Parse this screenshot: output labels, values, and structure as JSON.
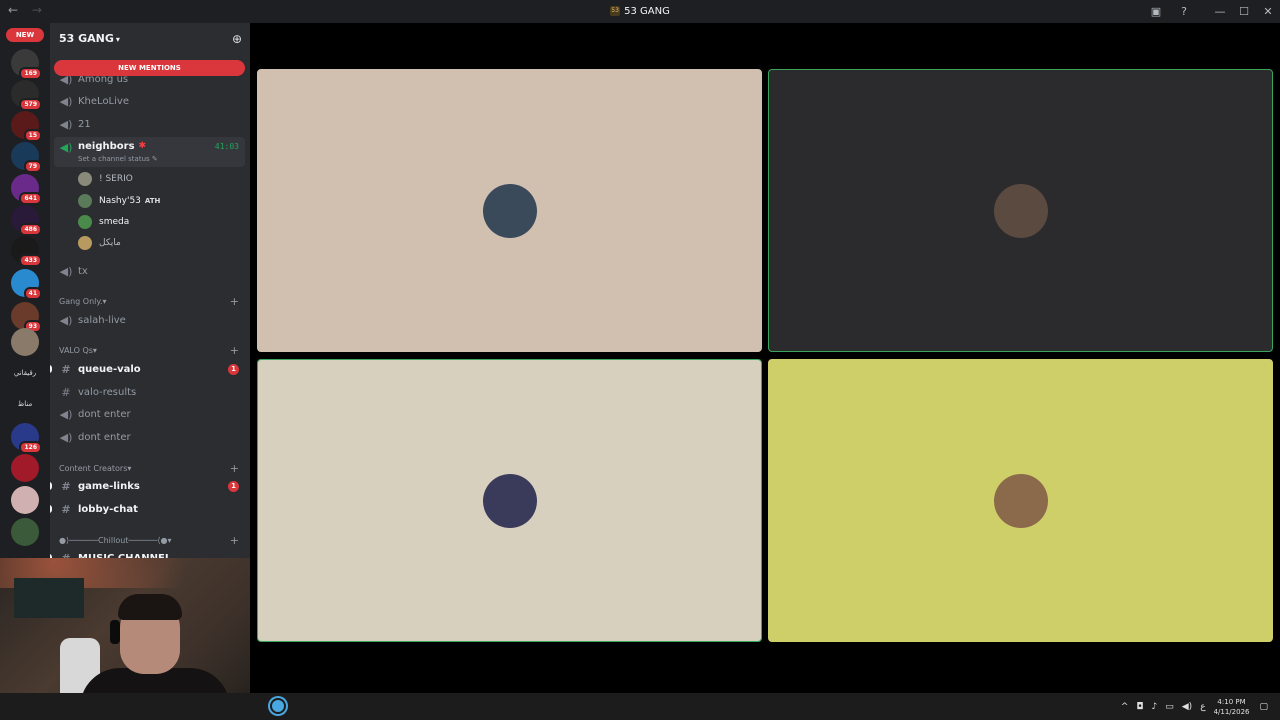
{
  "window": {
    "title": "53 GANG",
    "title_logo": "53",
    "nav_back": "←",
    "nav_forward": "→",
    "icons": [
      "inbox-icon",
      "help-icon",
      "minimize-icon",
      "maximize-icon",
      "close-icon"
    ]
  },
  "servers": {
    "new_label": "NEW",
    "items": [
      {
        "badge": "169",
        "color": "#3a3a3a"
      },
      {
        "badge": "579",
        "color": "#2b2b2b"
      },
      {
        "badge": "15",
        "color": "#5a1a1a"
      },
      {
        "badge": "79",
        "color": "#1a3a5a"
      },
      {
        "badge": "641",
        "color": "#6a2a8a"
      },
      {
        "badge": "486",
        "color": "#2a1a3a"
      },
      {
        "badge": "433",
        "color": "#1a1a1a"
      },
      {
        "badge": "41",
        "color": "#2a8ad0"
      },
      {
        "badge": "93",
        "color": "#6a3a2a"
      },
      {
        "badge": "",
        "color": "#8a7a6a"
      },
      {
        "badge": "",
        "color": "#1e1f22"
      },
      {
        "badge": "",
        "color": "#1e1f22"
      },
      {
        "badge": "126",
        "color": "#2a3a8a"
      },
      {
        "badge": "",
        "color": "#a01a2a"
      },
      {
        "badge": "",
        "color": "#d0b0b0"
      },
      {
        "badge": "",
        "color": "#3a5a3a"
      }
    ],
    "text_items": [
      "رقيقاني",
      "مناظ"
    ]
  },
  "guild": {
    "name": "53 GANG",
    "new_mentions": "NEW MENTIONS"
  },
  "channels": {
    "top": [
      {
        "name": "Among us",
        "icon": "speaker-icon"
      },
      {
        "name": "KheLoLive",
        "icon": "speaker-icon"
      },
      {
        "name": "21",
        "icon": "speaker-icon"
      }
    ],
    "active": {
      "name": "neighbors",
      "timer": "41:03",
      "status": "Set a channel status"
    },
    "voice_users": [
      {
        "name": "! SERIO",
        "color": "#8a8a7a",
        "bold": false,
        "tag": ""
      },
      {
        "name": "Nashy'53",
        "color": "#5a7a5a",
        "bold": true,
        "tag": "ATH"
      },
      {
        "name": "smeda",
        "color": "#4a8a4a",
        "bold": true,
        "tag": ""
      },
      {
        "name": "مايكل",
        "color": "#b89a60",
        "bold": false,
        "tag": ""
      }
    ],
    "after": {
      "name": "tx"
    },
    "categories": [
      {
        "name": "Gang Only.",
        "channels": [
          {
            "name": "salah-live",
            "icon": "speaker",
            "bold": false,
            "badge": ""
          }
        ]
      },
      {
        "name": "VALO Qs",
        "channels": [
          {
            "name": "queue-valo",
            "icon": "hash",
            "bold": true,
            "badge": "1"
          },
          {
            "name": "valo-results",
            "icon": "hash",
            "bold": false,
            "badge": ""
          },
          {
            "name": "dont enter",
            "icon": "speaker",
            "bold": false,
            "badge": ""
          },
          {
            "name": "dont enter",
            "icon": "speaker",
            "bold": false,
            "badge": ""
          }
        ]
      },
      {
        "name": "Content Creators",
        "channels": [
          {
            "name": "game-links",
            "icon": "hash",
            "bold": true,
            "badge": "1"
          },
          {
            "name": "lobby-chat",
            "icon": "hash",
            "bold": true,
            "badge": ""
          }
        ]
      },
      {
        "name": "●⟩──────Chillout──────⟨●",
        "channels": [
          {
            "name": "MUSIC CHANNEL",
            "icon": "hash",
            "bold": true,
            "badge": ""
          }
        ]
      }
    ]
  },
  "stage": {
    "tiles": [
      {
        "bg": "#d1bfb0",
        "border": "#d1bfb0",
        "avatar": "#3a4a5a"
      },
      {
        "bg": "#2b2a2d",
        "border": "#3ba55c",
        "avatar": "#5a4a40"
      },
      {
        "bg": "#d8d0bf",
        "border": "#3ba55c",
        "avatar": "#3a3a5a"
      },
      {
        "bg": "#cfcf6a",
        "border": "#cfcf6a",
        "avatar": "#8a6a4a"
      }
    ]
  },
  "taskbar": {
    "time": "4:10 PM",
    "date": "4/11/2026",
    "lang": "ع",
    "icons": [
      "chevron-up-icon",
      "camera-icon",
      "mic-icon",
      "network-icon",
      "volume-icon",
      "notification-icon"
    ]
  }
}
